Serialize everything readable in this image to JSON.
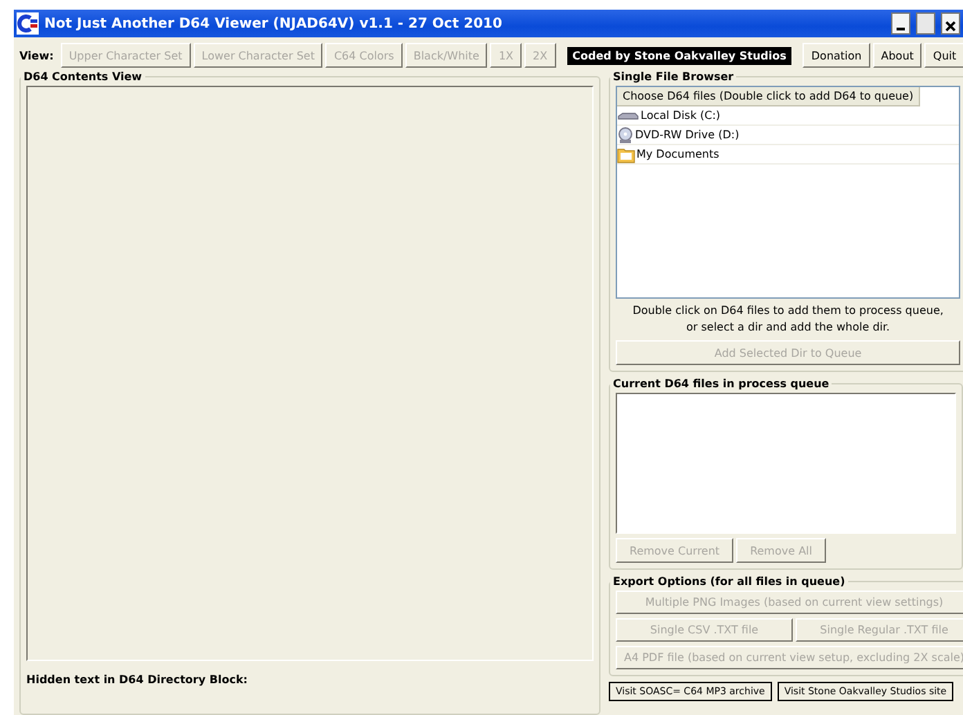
{
  "window": {
    "title": "Not Just Another D64 Viewer (NJAD64V) v1.1 - 27 Oct 2010"
  },
  "toolbar": {
    "view_label": "View:",
    "view_buttons": [
      {
        "label": "Upper Character Set",
        "disabled": true
      },
      {
        "label": "Lower Character Set",
        "disabled": true
      },
      {
        "label": "C64 Colors",
        "disabled": true
      },
      {
        "label": "Black/White",
        "disabled": true
      },
      {
        "label": "1X",
        "disabled": true
      },
      {
        "label": "2X",
        "disabled": true
      }
    ],
    "credit": "Coded by Stone Oakvalley Studios",
    "actions": [
      {
        "label": "Donation"
      },
      {
        "label": "About"
      },
      {
        "label": "Quit"
      }
    ]
  },
  "contents_panel": {
    "title": "D64 Contents View",
    "hidden_text_label": "Hidden text in D64 Directory Block:"
  },
  "file_browser": {
    "title": "Single File Browser",
    "column_header": "Choose D64 files (Double click to add D64 to queue)",
    "items": [
      {
        "label": "Local Disk (C:)",
        "kind": "drive"
      },
      {
        "label": "DVD-RW Drive (D:)",
        "kind": "dvd"
      },
      {
        "label": "My Documents",
        "kind": "folder"
      }
    ],
    "hint": "Double click on D64 files to add them to process queue, or select a dir and add the whole dir.",
    "add_button": {
      "label": "Add Selected Dir to Queue",
      "disabled": true
    }
  },
  "queue": {
    "title": "Current D64 files in process queue",
    "buttons": [
      {
        "label": "Remove Current",
        "disabled": true
      },
      {
        "label": "Remove All",
        "disabled": true
      }
    ]
  },
  "export": {
    "title": "Export Options (for all files in queue)",
    "rows": [
      [
        {
          "label": "Multiple PNG Images (based on current view settings)",
          "disabled": true
        }
      ],
      [
        {
          "label": "Single CSV .TXT file",
          "disabled": true
        },
        {
          "label": "Single Regular .TXT file",
          "disabled": true
        }
      ],
      [
        {
          "label": "A4 PDF file (based on current view setup, excluding 2X scale)",
          "disabled": true
        }
      ]
    ]
  },
  "links": [
    {
      "label": "Visit SOASC= C64 MP3 archive"
    },
    {
      "label": "Visit Stone Oakvalley Studios site"
    }
  ]
}
